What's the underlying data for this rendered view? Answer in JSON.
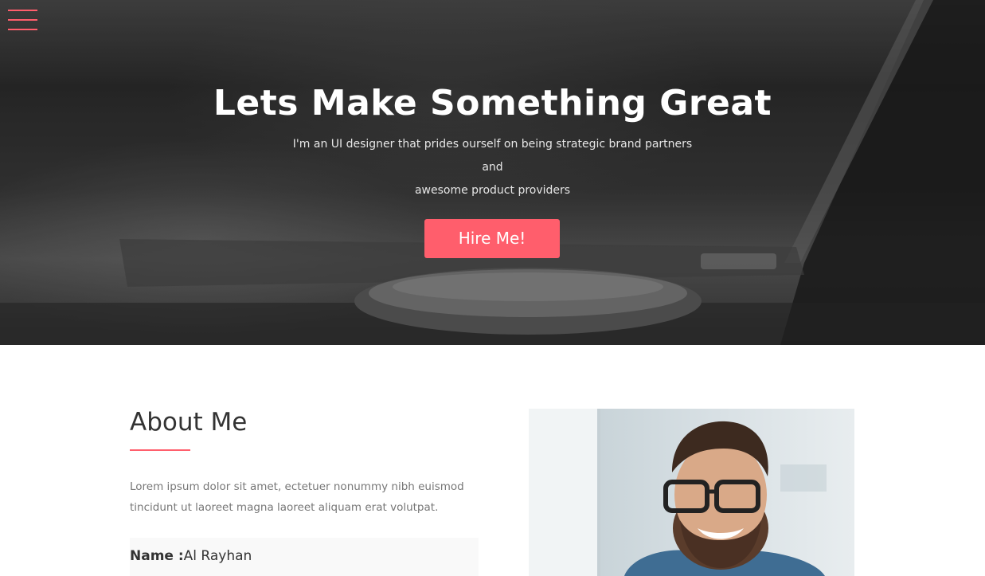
{
  "nav": {
    "menu_icon": "hamburger-menu-icon"
  },
  "hero": {
    "title": "Lets Make Something Great",
    "subtitle_line1": "I'm an UI designer that prides ourself on being strategic brand partners and",
    "subtitle_line2": "awesome product providers",
    "cta_label": "Hire Me!"
  },
  "about": {
    "heading": "About Me",
    "text_line1": "Lorem ipsum dolor sit amet, ectetuer nonummy nibh euismod",
    "text_line2": "tincidunt ut laoreet magna laoreet aliquam erat volutpat.",
    "name_label": "Name :",
    "name_value": "Al Rayhan"
  },
  "colors": {
    "accent": "#ff5e6c",
    "heading": "#333333",
    "body_text": "#777777"
  }
}
